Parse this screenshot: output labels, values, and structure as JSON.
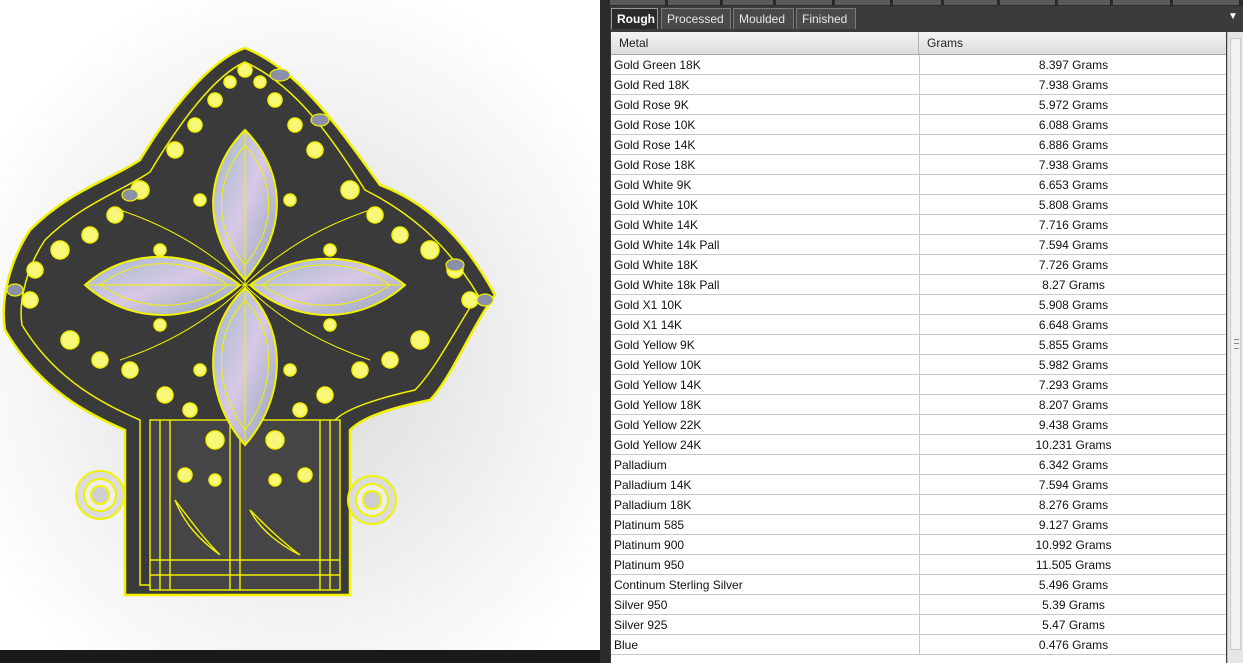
{
  "tabs": [
    {
      "label": "Rough",
      "active": true
    },
    {
      "label": "Processed",
      "active": false
    },
    {
      "label": "Moulded",
      "active": false
    },
    {
      "label": "Finished",
      "active": false
    }
  ],
  "tabs_dropdown_icon": "chevron-down-icon",
  "table": {
    "headers": {
      "metal": "Metal",
      "grams": "Grams"
    },
    "rows": [
      {
        "metal": "Gold Green 18K",
        "grams": "8.397 Grams"
      },
      {
        "metal": "Gold Red 18K",
        "grams": "7.938 Grams"
      },
      {
        "metal": "Gold Rose 9K",
        "grams": "5.972 Grams"
      },
      {
        "metal": "Gold Rose 10K",
        "grams": "6.088 Grams"
      },
      {
        "metal": "Gold Rose 14K",
        "grams": "6.886 Grams"
      },
      {
        "metal": "Gold Rose 18K",
        "grams": "7.938 Grams"
      },
      {
        "metal": "Gold White 9K",
        "grams": "6.653 Grams"
      },
      {
        "metal": "Gold White 10K",
        "grams": "5.808 Grams"
      },
      {
        "metal": "Gold White 14K",
        "grams": "7.716 Grams"
      },
      {
        "metal": "Gold White 14k Pall",
        "grams": "7.594 Grams"
      },
      {
        "metal": "Gold White 18K",
        "grams": "7.726 Grams"
      },
      {
        "metal": "Gold White 18k Pall",
        "grams": "8.27 Grams"
      },
      {
        "metal": "Gold X1 10K",
        "grams": "5.908 Grams"
      },
      {
        "metal": "Gold X1 14K",
        "grams": "6.648 Grams"
      },
      {
        "metal": "Gold Yellow 9K",
        "grams": "5.855 Grams"
      },
      {
        "metal": "Gold Yellow 10K",
        "grams": "5.982 Grams"
      },
      {
        "metal": "Gold Yellow 14K",
        "grams": "7.293 Grams"
      },
      {
        "metal": "Gold Yellow 18K",
        "grams": "8.207 Grams"
      },
      {
        "metal": "Gold Yellow 22K",
        "grams": "9.438 Grams"
      },
      {
        "metal": "Gold Yellow 24K",
        "grams": "10.231 Grams"
      },
      {
        "metal": "Palladium",
        "grams": "6.342 Grams"
      },
      {
        "metal": "Palladium 14K",
        "grams": "7.594 Grams"
      },
      {
        "metal": "Palladium 18K",
        "grams": "8.276 Grams"
      },
      {
        "metal": "Platinum 585",
        "grams": "9.127 Grams"
      },
      {
        "metal": "Platinum 900",
        "grams": "10.992 Grams"
      },
      {
        "metal": "Platinum 950",
        "grams": "11.505 Grams"
      },
      {
        "metal": "Continum Sterling Silver",
        "grams": "5.496 Grams"
      },
      {
        "metal": "Silver 950",
        "grams": "5.39 Grams"
      },
      {
        "metal": "Silver 925",
        "grams": "5.47 Grams"
      },
      {
        "metal": "Blue",
        "grams": "0.476 Grams"
      }
    ]
  },
  "colors": {
    "wireframe": "#f2f200",
    "panel_bg": "#3b3b3b",
    "grid_bg": "#ffffff",
    "viewport_bg": "#ffffff"
  },
  "viewport": {
    "model_icon": "pendant-wireframe-icon"
  }
}
